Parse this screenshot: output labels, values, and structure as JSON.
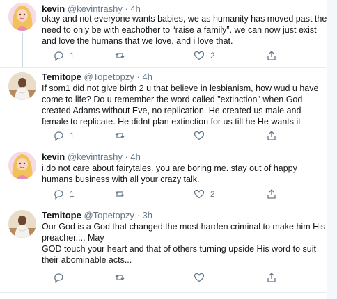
{
  "tweets": [
    {
      "name": "kevin",
      "handle": "@kevintrashy",
      "dot": "·",
      "time": "4h",
      "text": "okay and not everyone wants babies, we as humanity has moved past the need to only be with eachother to “raise a family”. we can now just exist and love the humans that we love, and i love that.",
      "reply_count": "1",
      "retweet_count": "",
      "like_count": "2"
    },
    {
      "name": "Temitope",
      "handle": "@Topetopzy",
      "dot": "·",
      "time": "4h",
      "text": "If som1 did not give birth 2 u that believe in lesbianism,  how wud u have come to life? Do u remember the word called \"extinction\" when God created Adams without Eve, no replication.  He created us male and female to replicate. He didnt plan extinction for us till he He wants it",
      "reply_count": "1",
      "retweet_count": "",
      "like_count": ""
    },
    {
      "name": "kevin",
      "handle": "@kevintrashy",
      "dot": "·",
      "time": "4h",
      "text": "i do not care about fairytales. you are boring me. stay out of happy humans business with all your crazy talk.",
      "reply_count": "1",
      "retweet_count": "",
      "like_count": "2"
    },
    {
      "name": "Temitope",
      "handle": "@Topetopzy",
      "dot": "·",
      "time": "3h",
      "text": "Our God is a God that changed the most harden criminal to make him His preacher.... May\nGOD touch your heart and that of others turning upside His word to suit their abominable acts...",
      "reply_count": "",
      "retweet_count": "",
      "like_count": ""
    }
  ],
  "icons": {
    "reply": "reply-icon",
    "retweet": "retweet-icon",
    "like": "heart-icon",
    "share": "share-icon"
  },
  "colors": {
    "text": "#14171a",
    "muted": "#657786",
    "rail": "#ccd6dd",
    "divider": "#e6ecf0"
  }
}
